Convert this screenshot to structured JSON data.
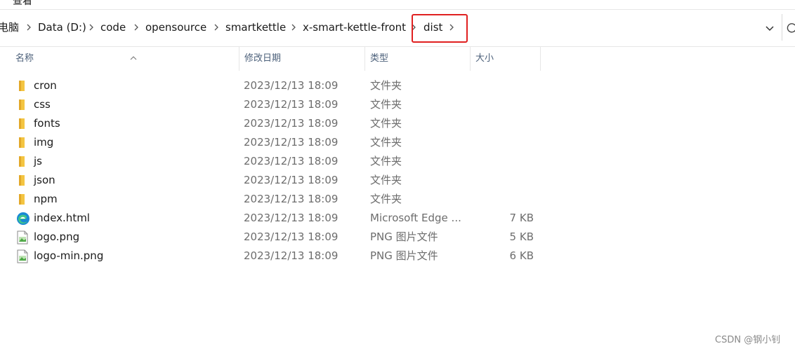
{
  "menu": {
    "view_label": "查看"
  },
  "address": {
    "crumbs": [
      "电脑",
      "Data (D:)",
      "code",
      "opensource",
      "smartkettle",
      "x-smart-kettle-front",
      "dist"
    ]
  },
  "columns": {
    "name": "名称",
    "date": "修改日期",
    "type": "类型",
    "size": "大小"
  },
  "files": [
    {
      "name": "cron",
      "date": "2023/12/13 18:09",
      "type": "文件夹",
      "size": "",
      "icon": "folder-icon"
    },
    {
      "name": "css",
      "date": "2023/12/13 18:09",
      "type": "文件夹",
      "size": "",
      "icon": "folder-icon"
    },
    {
      "name": "fonts",
      "date": "2023/12/13 18:09",
      "type": "文件夹",
      "size": "",
      "icon": "folder-icon"
    },
    {
      "name": "img",
      "date": "2023/12/13 18:09",
      "type": "文件夹",
      "size": "",
      "icon": "folder-icon"
    },
    {
      "name": "js",
      "date": "2023/12/13 18:09",
      "type": "文件夹",
      "size": "",
      "icon": "folder-icon"
    },
    {
      "name": "json",
      "date": "2023/12/13 18:09",
      "type": "文件夹",
      "size": "",
      "icon": "folder-icon"
    },
    {
      "name": "npm",
      "date": "2023/12/13 18:09",
      "type": "文件夹",
      "size": "",
      "icon": "folder-icon"
    },
    {
      "name": "index.html",
      "date": "2023/12/13 18:09",
      "type": "Microsoft Edge ...",
      "size": "7 KB",
      "icon": "edge-icon"
    },
    {
      "name": "logo.png",
      "date": "2023/12/13 18:09",
      "type": "PNG 图片文件",
      "size": "5 KB",
      "icon": "image-file-icon"
    },
    {
      "name": "logo-min.png",
      "date": "2023/12/13 18:09",
      "type": "PNG 图片文件",
      "size": "6 KB",
      "icon": "image-file-icon"
    }
  ],
  "watermark": "CSDN @钢小钊",
  "colors": {
    "highlight": "#e02020",
    "folder": "#f4c542",
    "header_text": "#4c607a"
  }
}
